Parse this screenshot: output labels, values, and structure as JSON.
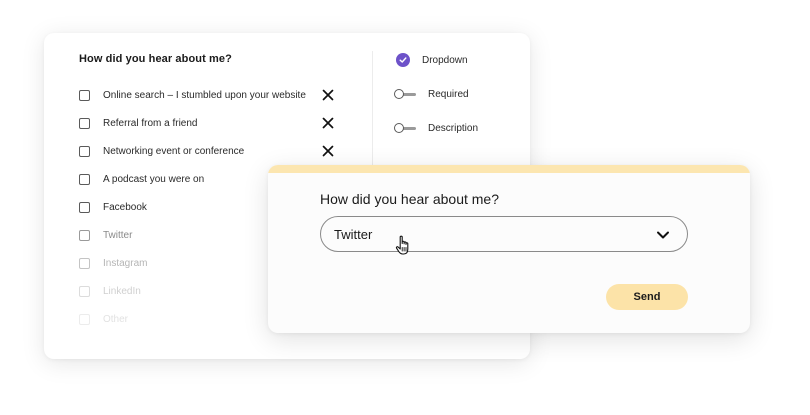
{
  "builder": {
    "title": "How did you hear about me?",
    "options": [
      {
        "label": "Online search – I stumbled upon your website",
        "removable": true
      },
      {
        "label": "Referral from a friend",
        "removable": true
      },
      {
        "label": "Networking event or conference",
        "removable": true
      },
      {
        "label": "A podcast you were on",
        "removable": false
      },
      {
        "label": "Facebook",
        "removable": false
      },
      {
        "label": "Twitter",
        "removable": false
      },
      {
        "label": "Instagram",
        "removable": false
      },
      {
        "label": "LinkedIn",
        "removable": false
      },
      {
        "label": "Other",
        "removable": false
      }
    ],
    "settings": [
      {
        "label": "Dropdown",
        "control": "check-circle",
        "enabled": true
      },
      {
        "label": "Required",
        "control": "toggle",
        "enabled": false
      },
      {
        "label": "Description",
        "control": "toggle",
        "enabled": false
      }
    ]
  },
  "preview": {
    "question": "How did you hear about me?",
    "selected_value": "Twitter",
    "send_label": "Send"
  },
  "colors": {
    "accent_purple": "#6d52c9",
    "send_button": "#fce3a8",
    "preview_topbar": "#fce6b0"
  },
  "icons": {
    "remove": "close-icon",
    "dropdown": "chevron-down-icon",
    "pointer": "hand-cursor-icon",
    "enabled_setting": "check-circle-icon"
  }
}
